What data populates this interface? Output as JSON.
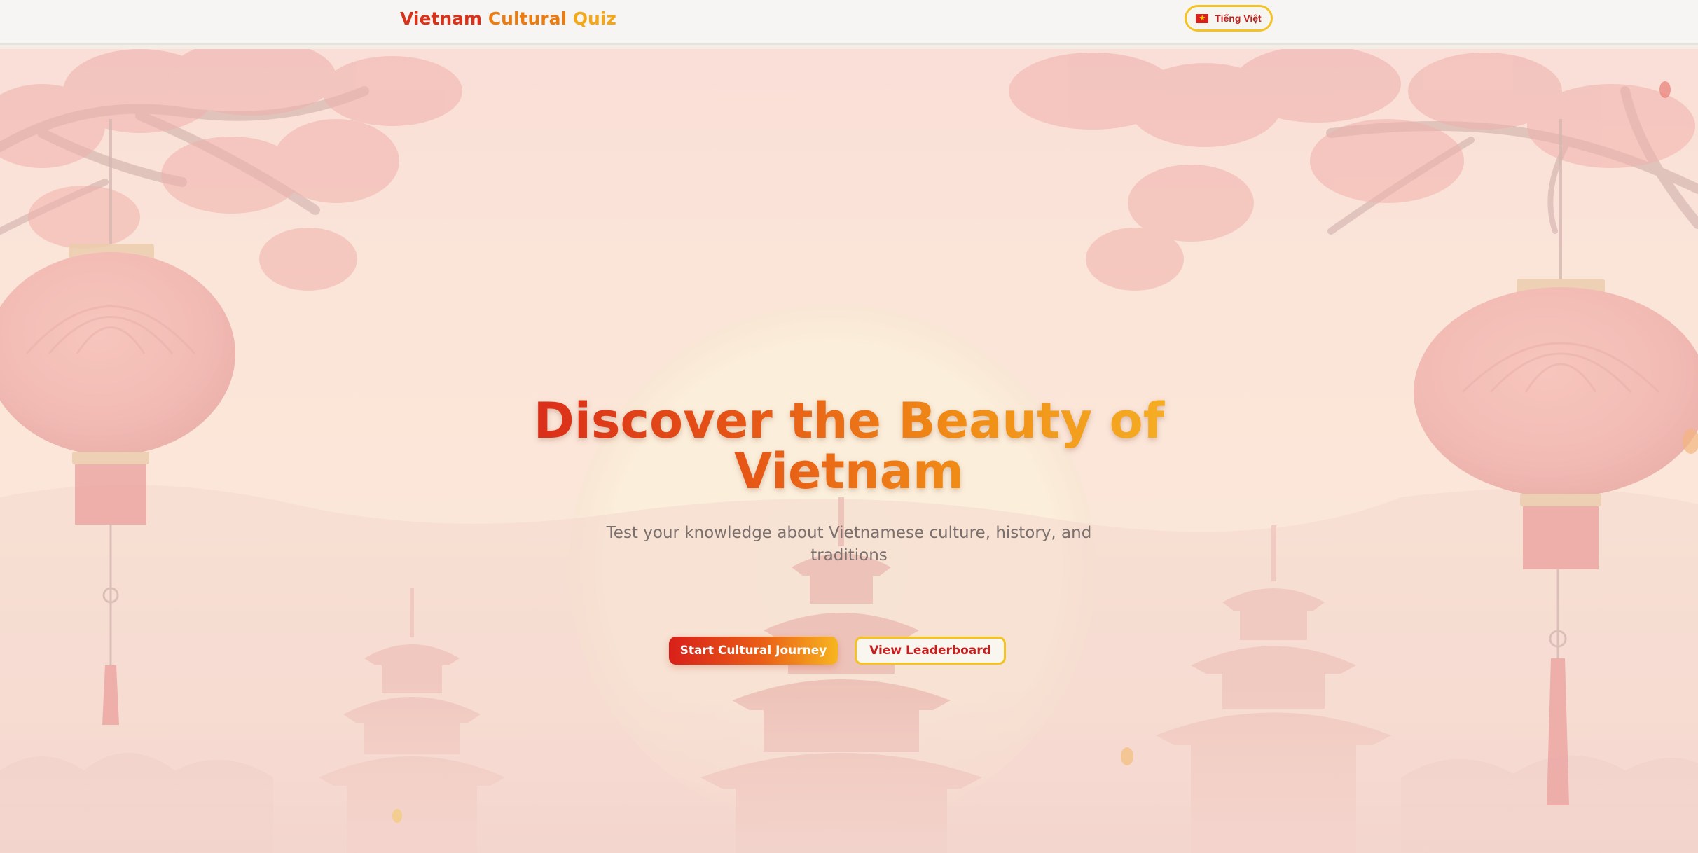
{
  "header": {
    "brand": {
      "word1": "Vietnam",
      "word2": "Cultural",
      "word3": "Quiz"
    },
    "language_button": {
      "label": "Tiếng Việt",
      "flag_icon": "vietnam-flag-icon"
    }
  },
  "hero": {
    "title": "Discover the Beauty of Vietnam",
    "subtitle": "Test your knowledge about Vietnamese culture, history, and traditions",
    "primary_button": "Start Cultural Journey",
    "secondary_button": "View Leaderboard"
  },
  "colors": {
    "brand_red": "#d8321a",
    "brand_orange": "#ea7c12",
    "brand_gold": "#f3a81c",
    "button_border_gold": "#f5c321",
    "subtitle_gray": "#7b706d"
  }
}
